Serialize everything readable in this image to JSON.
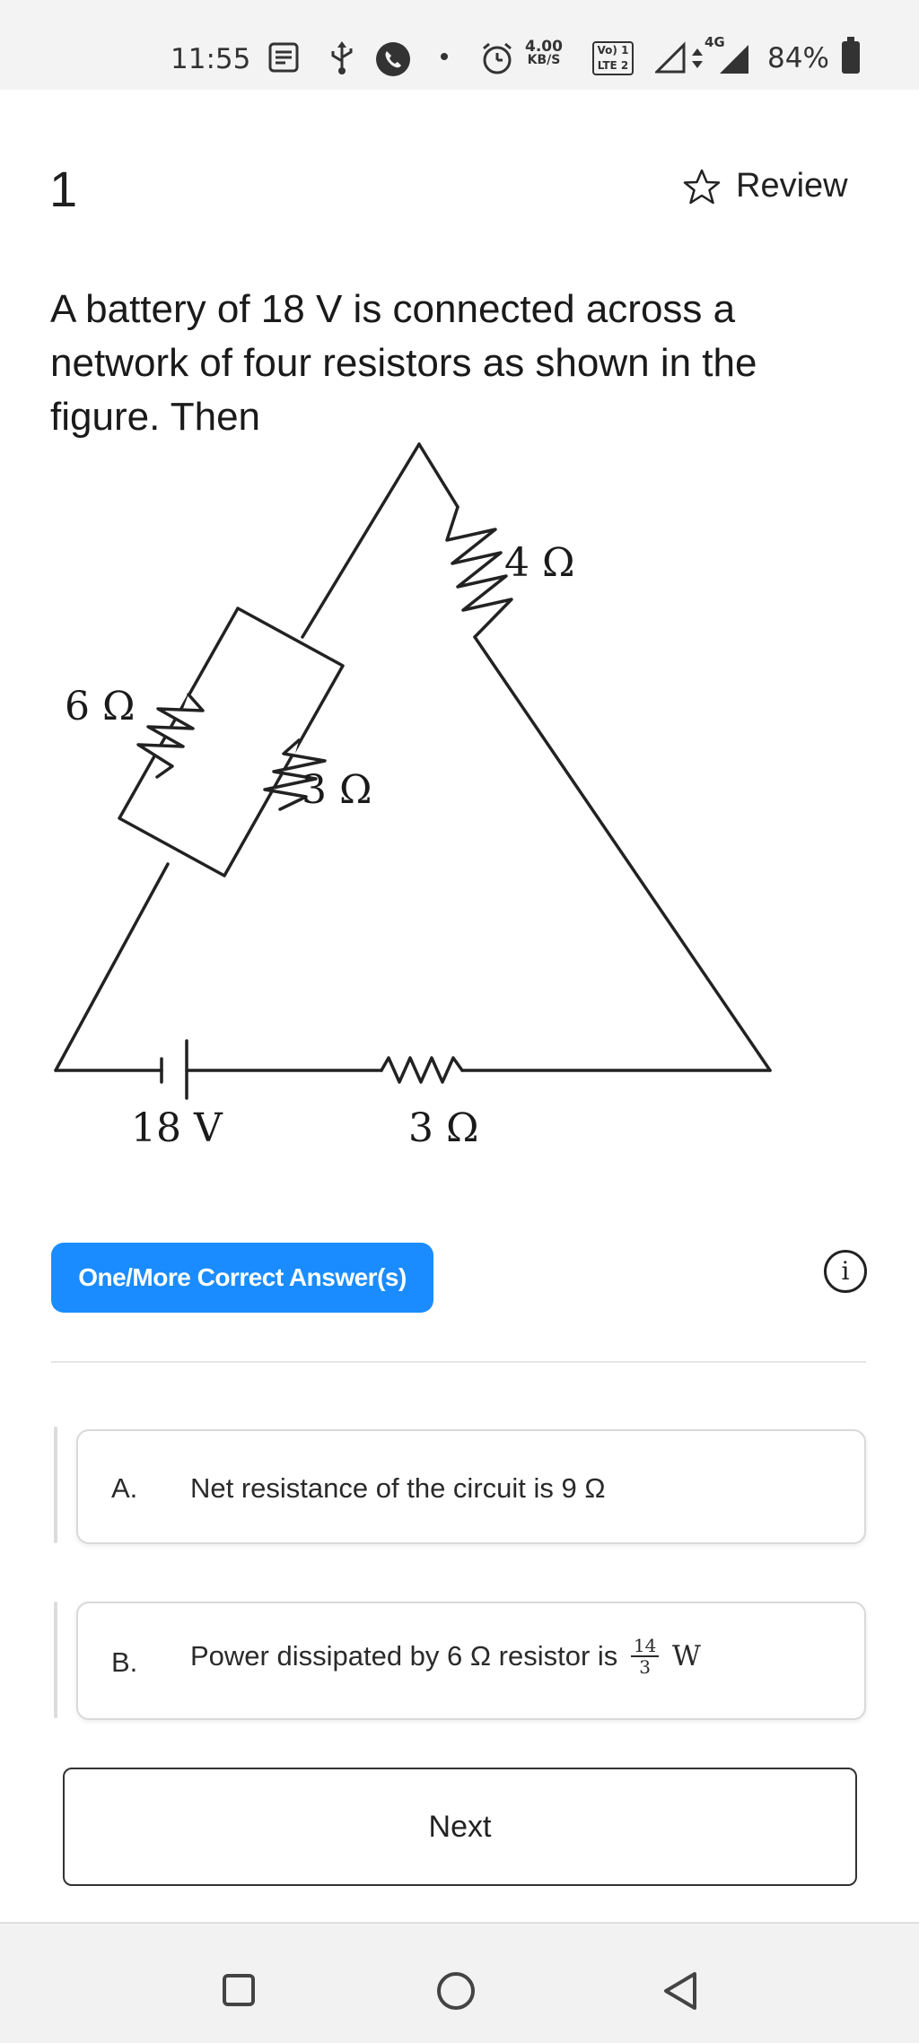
{
  "status_bar": {
    "time": "11:55",
    "net_speed_value": "4.00",
    "net_speed_unit": "KB/S",
    "lte_line1": "Vo) 1",
    "lte_line2": "LTE 2",
    "network": "4G",
    "battery": "84%"
  },
  "question": {
    "number": "1",
    "review_label": "Review",
    "text": "A battery of 18 V is connected across a network of four resistors as shown in the figure. Then"
  },
  "figure": {
    "labels": {
      "r_top_right": "4 Ω",
      "r_left_outer": "6 Ω",
      "r_left_inner": "3 Ω",
      "battery": "18 V",
      "r_bottom": "3 Ω"
    }
  },
  "answer_type": {
    "label": "One/More Correct Answer(s)",
    "info_glyph": "i"
  },
  "options": [
    {
      "letter": "A.",
      "text_prefix": "Net resistance of the circuit is 9 Ω"
    },
    {
      "letter": "B.",
      "text_prefix": "Power dissipated by 6 Ω resistor is",
      "fraction_num": "14",
      "fraction_den": "3",
      "unit": "W"
    }
  ],
  "next_button": {
    "label": "Next"
  }
}
